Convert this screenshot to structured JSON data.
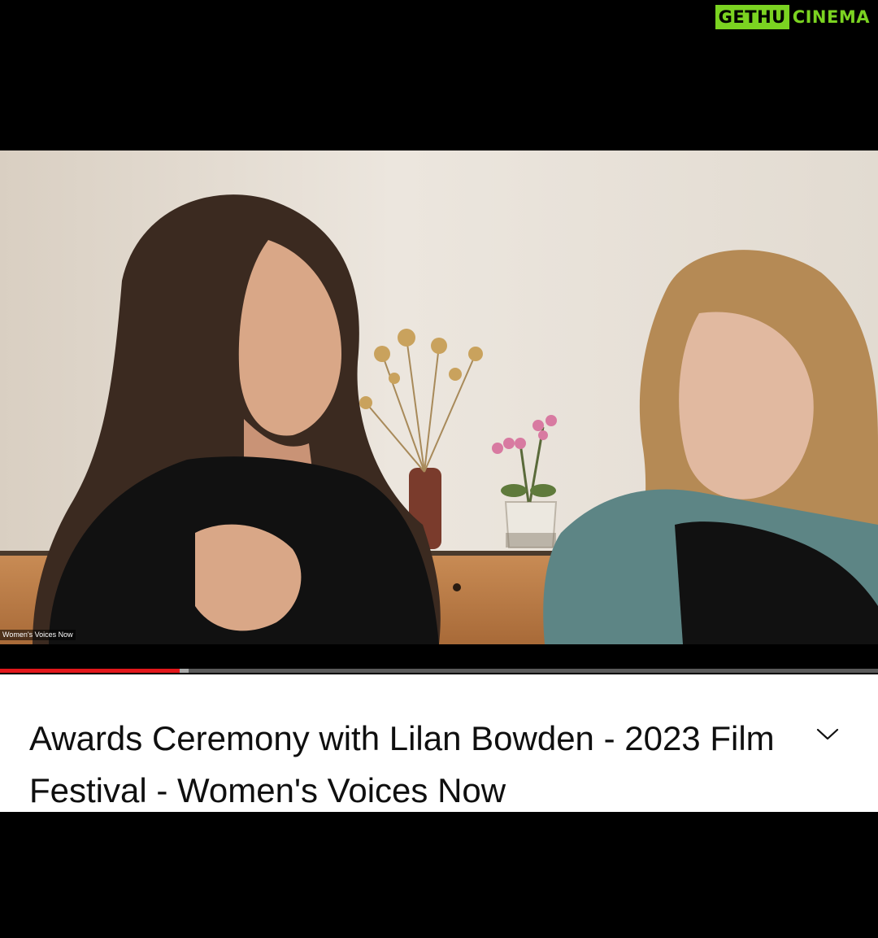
{
  "watermark": {
    "part1": "GETHU",
    "part2": "CINEMA",
    "colors": {
      "accent": "#7bd321",
      "dark": "#000000"
    }
  },
  "video": {
    "participant_label": "Women's Voices Now",
    "progress": 0.205,
    "buffered": 0.215
  },
  "info": {
    "title": "Awards Ceremony with Lilan Bowden - 2023 Film Festival - Women's Voices Now",
    "expand_icon": "chevron-down-icon"
  },
  "colors": {
    "progress_played": "#e3171b",
    "progress_track": "#5a5a5a",
    "panel_bg": "#ffffff",
    "title_text": "#0f0f0f"
  }
}
